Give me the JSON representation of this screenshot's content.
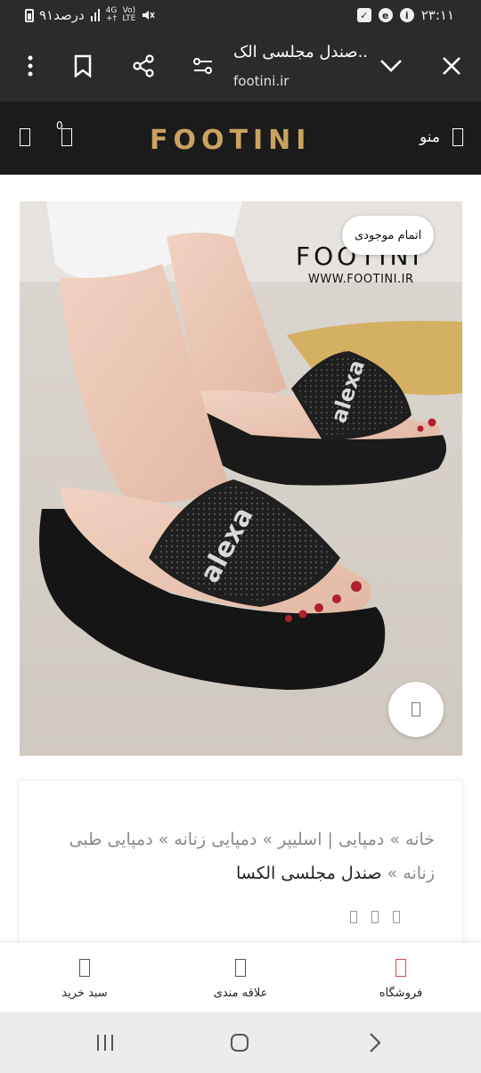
{
  "status_bar": {
    "time": "۲۳:۱۱",
    "battery_text": "۹۱درصد",
    "network_top": "4G",
    "network_bottom": "+†",
    "volte_top": "Vo)",
    "volte_bottom": "LTE"
  },
  "browser": {
    "title": "صندل مجلسی الک..",
    "url": "footini.ir"
  },
  "site_header": {
    "logo": "FOOTINI",
    "menu_label": "منو",
    "cart_count": "0"
  },
  "product": {
    "stock_badge": "اتمام موجودی",
    "image_brand": "FOOTINI",
    "image_url": "WWW.FOOTINI.IR",
    "strap_text": "alexa"
  },
  "breadcrumb": {
    "path": "خانه » دمپایی | اسلیپر » دمپایی زنانه » دمپایی طبی زنانه » ",
    "current": "صندل مجلسی الکسا"
  },
  "bottom_nav": {
    "items": [
      {
        "label": "فروشگاه",
        "icon": "store-icon",
        "active": true
      },
      {
        "label": "علاقه مندی",
        "icon": "heart-icon",
        "active": false
      },
      {
        "label": "سبد خرید",
        "icon": "cart-icon",
        "active": false
      }
    ]
  },
  "colors": {
    "dark_bar": "#2b2b2b",
    "site_header": "#1b1b1b",
    "logo_gold": "#c9a35f",
    "accent_red": "#e04a4a"
  }
}
